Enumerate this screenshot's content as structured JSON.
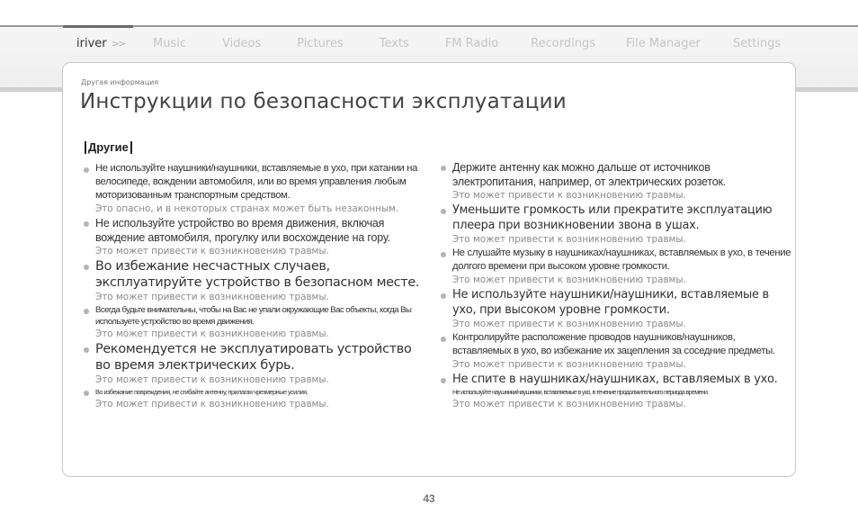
{
  "nav": {
    "brand": "iriver",
    "arrow": ">>",
    "items": [
      "Music",
      "Videos",
      "Pictures",
      "Texts",
      "FM Radio",
      "Recordings",
      "File Manager",
      "Settings"
    ]
  },
  "crumb": "Другая информация",
  "title": "Инструкции по безопасности эксплуатации",
  "section": "Другие",
  "left": [
    {
      "text": "Не используйте наушники/наушники, вставляемые в ухо, при катании на велосипеде, вождении автомобиля, или во время управления любым моторизованным транспортным средством.",
      "warning": "Это опасно, и в некоторых странах может быть незаконным."
    },
    {
      "text": "Не используйте устройство во время движения, включая вождение автомобиля, прогулку или восхождение на гору.",
      "warning": "Это может привести к возникновению травмы."
    },
    {
      "text": "Во избежание несчастных случаев, эксплуатируйте устройство в безопасном месте.",
      "warning": "Это может привести к возникновению травмы."
    },
    {
      "text": "Всегда будьте внимательны, чтобы на Вас не упали окружающие Вас объекты, когда Вы используете устройство во время движения.",
      "warning": "Это может привести к возникновению травмы."
    },
    {
      "text": "Рекомендуется не эксплуатировать устройство во время электрических бурь.",
      "warning": "Это может привести к возникновению травмы."
    },
    {
      "text": "Во избежание повреждения, не сгибайте антенну, прилагая чрезмерные усилия.",
      "warning": "Это может привести к возникновению травмы."
    }
  ],
  "right": [
    {
      "text": "Держите антенну как можно дальше от источников электропитания, например, от электрических розеток.",
      "warning": "Это может привести к возникновению травмы."
    },
    {
      "text": "Уменьшите громкость или прекратите эксплуатацию плеера при возникновении звона в ушах.",
      "warning": "Это может привести к возникновению травмы."
    },
    {
      "text": "Не слушайте музыку в наушниках/наушниках, вставляемых в ухо, в течение долгого времени при высоком уровне громкости.",
      "warning": "Это может привести к возникновению травмы."
    },
    {
      "text": "Не используйте наушники/наушники, вставляемые в ухо, при высоком уровне громкости.",
      "warning": "Это может привести к возникновению травмы."
    },
    {
      "text": "Контролируйте расположение проводов наушников/наушников, вставляемых в ухо, во избежание их зацепления за соседние предметы.",
      "warning": "Это может привести к возникновению травмы."
    },
    {
      "text": "Не спите в наушниках/наушниках, вставляемых в ухо.",
      "subtext": "Не используйте наушники/наушники, вставляемые в ухо, в течение продолжительного периода времени.",
      "warning": "Это может привести к возникновению травмы."
    }
  ],
  "page_number": "43"
}
